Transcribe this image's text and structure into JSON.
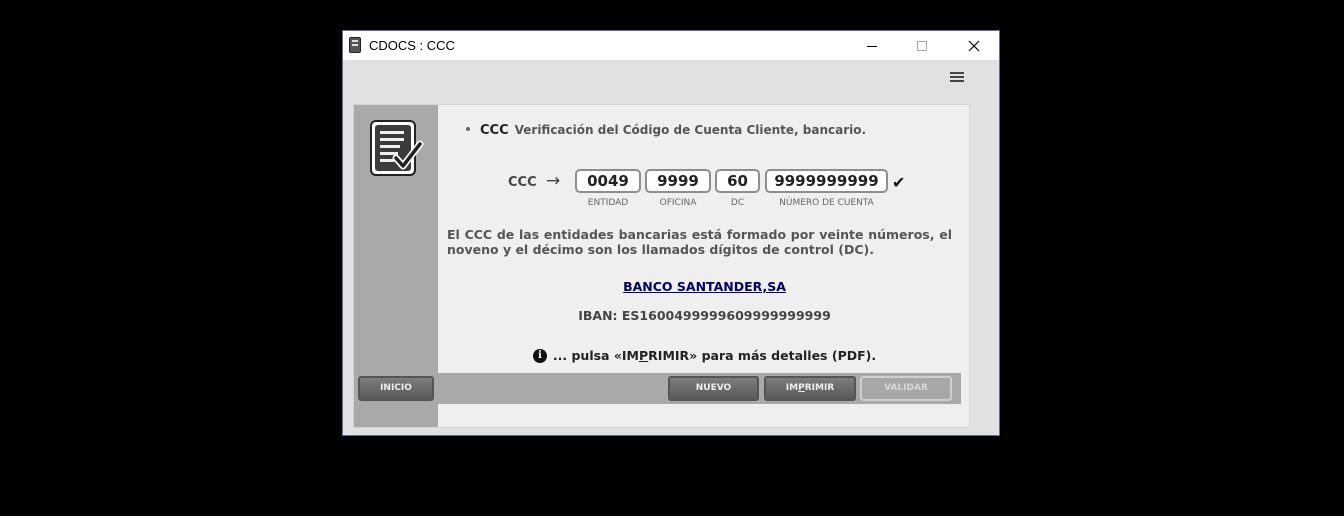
{
  "window": {
    "title": "CDOCS : CCC"
  },
  "header": {
    "bullet_title": "CCC",
    "bullet_text": "Verificación del Código de Cuenta Cliente, bancario."
  },
  "form": {
    "label": "CCC",
    "arrow": "→",
    "entidad": {
      "value": "0049",
      "caption": "ENTIDAD"
    },
    "oficina": {
      "value": "9999",
      "caption": "OFICINA"
    },
    "dc": {
      "value": "60",
      "caption": "DC"
    },
    "cuenta": {
      "value": "9999999999",
      "caption": "NÚMERO DE CUENTA"
    },
    "valid_mark": "✔"
  },
  "description": "El CCC de las entidades bancarias está formado por veinte números, el noveno y el décimo son los llamados dígitos de control (DC).",
  "bank_name": "BANCO SANTANDER,SA",
  "iban": "IBAN: ES1600499999609999999999",
  "hint": {
    "icon": "i",
    "pre": "... pulsa «IM",
    "underlined": "P",
    "post": "RIMIR» para más detalles (PDF)."
  },
  "buttons": {
    "inicio": "INICIO",
    "nuevo": "NUEVO",
    "imprimir_pre": "IM",
    "imprimir_u": "P",
    "imprimir_post": "RIMIR",
    "validar": "VALIDAR"
  },
  "colors": {
    "sidebar": "#a9a9a9",
    "link": "#000066",
    "window_border": "#5a6f94"
  }
}
